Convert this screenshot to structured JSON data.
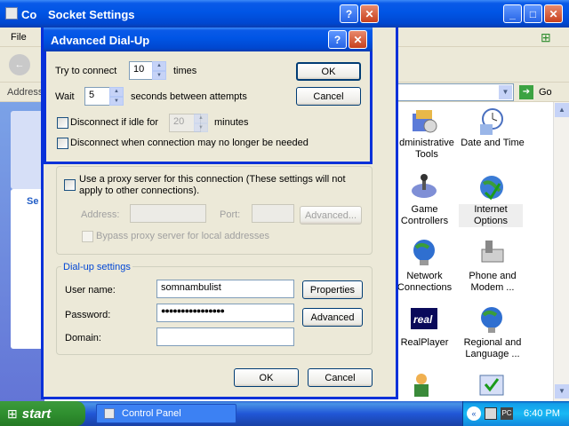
{
  "control_panel": {
    "title": "Co",
    "menu_file": "File",
    "address_label": "Address",
    "go_label": "Go",
    "side_se": "Se",
    "items": [
      {
        "label": "dministrative\nTools",
        "icon": "admin-tools-icon"
      },
      {
        "label": "Date and Time",
        "icon": "clock-icon"
      },
      {
        "label": "Game\nControllers",
        "icon": "joystick-icon"
      },
      {
        "label": "Internet\nOptions",
        "icon": "globe-icon"
      },
      {
        "label": "Network\nConnections",
        "icon": "network-globe-icon"
      },
      {
        "label": "Phone and\nModem ...",
        "icon": "phone-icon"
      },
      {
        "label": "RealPlayer",
        "icon": "realplayer-icon"
      },
      {
        "label": "Regional and\nLanguage ...",
        "icon": "regional-globe-icon"
      }
    ]
  },
  "socket_settings": {
    "title": "Socket Settings",
    "proxy": {
      "checkbox_label": "Use a proxy server for this connection (These settings will not apply to other connections).",
      "address_label": "Address:",
      "port_label": "Port:",
      "advanced_label": "Advanced...",
      "bypass_label": "Bypass proxy server for local addresses"
    },
    "dialup": {
      "group_title": "Dial-up settings",
      "username_label": "User name:",
      "username_value": "somnambulist",
      "password_label": "Password:",
      "password_value": "●●●●●●●●●●●●●●●●",
      "domain_label": "Domain:",
      "domain_value": "",
      "properties_label": "Properties",
      "advanced_label": "Advanced"
    },
    "ok_label": "OK",
    "cancel_label": "Cancel"
  },
  "advanced_dialup": {
    "title": "Advanced Dial-Up",
    "try_label": "Try to connect",
    "try_value": "10",
    "times_label": "times",
    "wait_label": "Wait",
    "wait_value": "5",
    "wait_suffix": "seconds between attempts",
    "idle_label": "Disconnect if idle for",
    "idle_value": "20",
    "minutes_label": "minutes",
    "disconnect_label": "Disconnect when connection may no longer be needed",
    "ok_label": "OK",
    "cancel_label": "Cancel"
  },
  "taskbar": {
    "start_label": "start",
    "task_label": "Control Panel",
    "clock": "6:40 PM"
  }
}
